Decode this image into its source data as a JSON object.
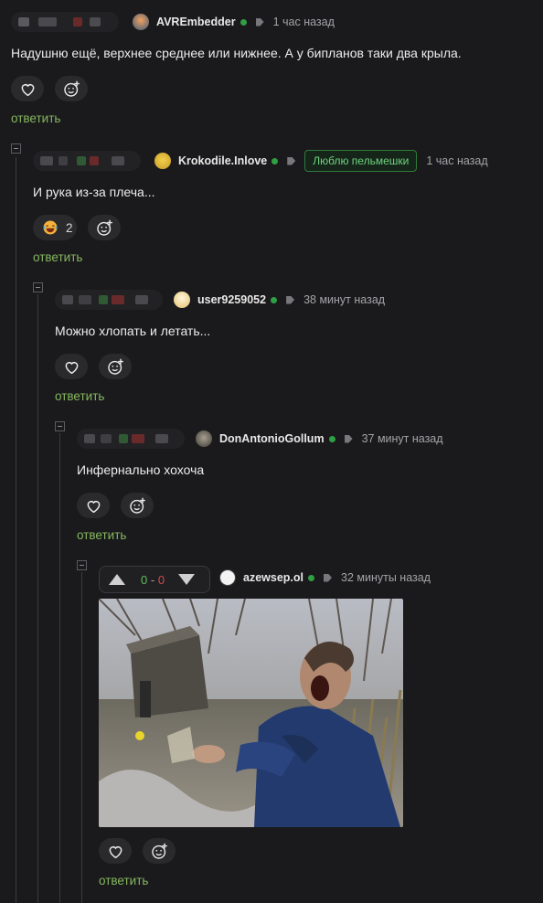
{
  "comments": [
    {
      "user": "AVREmbedder",
      "time": "1 час назад",
      "text": "Надушню ещё, верхнее среднее или нижнее. А у бипланов таки два крыла.",
      "reply": "ответить"
    },
    {
      "user": "Krokodile.Inlove",
      "badge": "Люблю пельмешки",
      "time": "1 час назад",
      "text": "И рука из-за плеча...",
      "reaction_count": "2",
      "reply": "ответить"
    },
    {
      "user": "user9259052",
      "time": "38 минут назад",
      "text": "Можно хлопать и летать...",
      "reply": "ответить"
    },
    {
      "user": "DonAntonioGollum",
      "time": "37 минут назад",
      "text": "Инфернально хохоча",
      "reply": "ответить"
    },
    {
      "user": "azewsep.ol",
      "time": "32 минуты назад",
      "rating_plus": "0",
      "rating_sep": "-",
      "rating_minus": "0",
      "reply": "ответить"
    }
  ],
  "icons": {
    "like": "heart-icon",
    "react": "smiley-plus-icon",
    "tag": "tag-icon",
    "collapse": "collapse-minus-icon",
    "up": "arrow-up-icon",
    "down": "arrow-down-icon"
  },
  "colors": {
    "background": "#1a1a1c",
    "reply_link": "#86b75e",
    "online": "#2ea043",
    "badge_text": "#6fd27f",
    "rating_plus": "#5fbf5f",
    "rating_minus": "#d24a4a"
  }
}
